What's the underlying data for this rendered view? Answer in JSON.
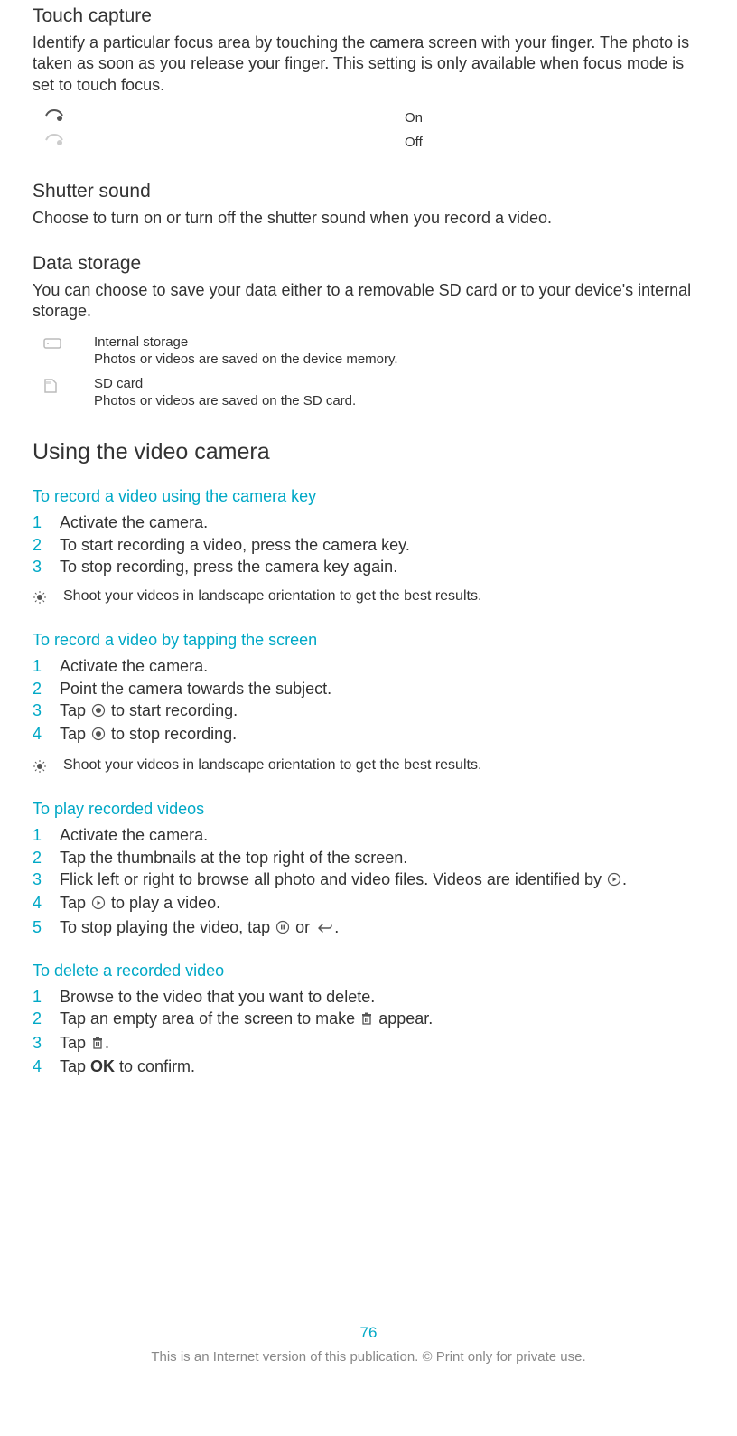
{
  "touchCapture": {
    "title": "Touch capture",
    "body": "Identify a particular focus area by touching the camera screen with your finger. The photo is taken as soon as you release your finger. This setting is only available when focus mode is set to touch focus.",
    "onLabel": "On",
    "offLabel": "Off"
  },
  "shutterSound": {
    "title": "Shutter sound",
    "body": "Choose to turn on or turn off the shutter sound when you record a video."
  },
  "dataStorage": {
    "title": "Data storage",
    "body": "You can choose to save your data either to a removable SD card or to your device's internal storage.",
    "internal": {
      "title": "Internal storage",
      "desc": "Photos or videos are saved on the device memory."
    },
    "sd": {
      "title": "SD card",
      "desc": "Photos or videos are saved on the SD card."
    }
  },
  "usingVideo": {
    "title": "Using the video camera"
  },
  "task1": {
    "heading": "To record a video using the camera key",
    "steps": [
      "Activate the camera.",
      "To start recording a video, press the camera key.",
      "To stop recording, press the camera key again."
    ],
    "tip": "Shoot your videos in landscape orientation to get the best results."
  },
  "task2": {
    "heading": "To record a video by tapping the screen",
    "step1": "Activate the camera.",
    "step2": "Point the camera towards the subject.",
    "step3a": "Tap ",
    "step3b": " to start recording.",
    "step4a": "Tap ",
    "step4b": " to stop recording.",
    "tip": "Shoot your videos in landscape orientation to get the best results."
  },
  "task3": {
    "heading": "To play recorded videos",
    "step1": "Activate the camera.",
    "step2": "Tap the thumbnails at the top right of the screen.",
    "step3a": "Flick left or right to browse all photo and video files. Videos are identified by ",
    "step3b": ".",
    "step4a": "Tap ",
    "step4b": " to play a video.",
    "step5a": "To stop playing the video, tap ",
    "step5b": " or ",
    "step5c": "."
  },
  "task4": {
    "heading": "To delete a recorded video",
    "step1": "Browse to the video that you want to delete.",
    "step2a": "Tap an empty area of the screen to make ",
    "step2b": " appear.",
    "step3a": "Tap ",
    "step3b": ".",
    "step4a": "Tap ",
    "step4ok": "OK",
    "step4b": " to confirm."
  },
  "footer": {
    "pageNumber": "76",
    "note": "This is an Internet version of this publication. © Print only for private use."
  }
}
